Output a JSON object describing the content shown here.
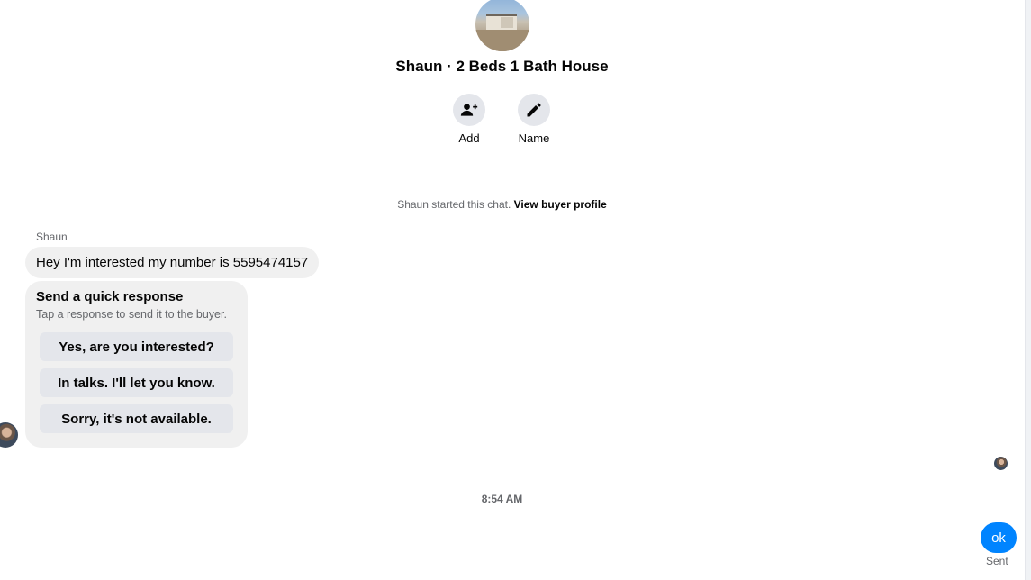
{
  "header": {
    "title": "Shaun · 2 Beds 1 Bath House",
    "actions": [
      {
        "label": "Add",
        "icon": "add-person-icon"
      },
      {
        "label": "Name",
        "icon": "pencil-icon"
      }
    ]
  },
  "system": {
    "started_text": "Shaun started this chat.",
    "view_profile_link": "View buyer profile"
  },
  "messages": {
    "sender_name": "Shaun",
    "incoming_text": "Hey I'm interested my number is 5595474157",
    "quick_response": {
      "title": "Send a quick response",
      "subtitle": "Tap a response to send it to the buyer.",
      "options": [
        "Yes, are you interested?",
        "In talks. I'll let you know.",
        "Sorry, it's not available."
      ]
    },
    "timestamp": "8:54 AM",
    "outgoing_text": "ok",
    "outgoing_status": "Sent"
  },
  "colors": {
    "accent": "#0084ff",
    "bubble_bg": "#f0f0f0",
    "button_bg": "#e4e6eb",
    "secondary_text": "#65676b"
  }
}
